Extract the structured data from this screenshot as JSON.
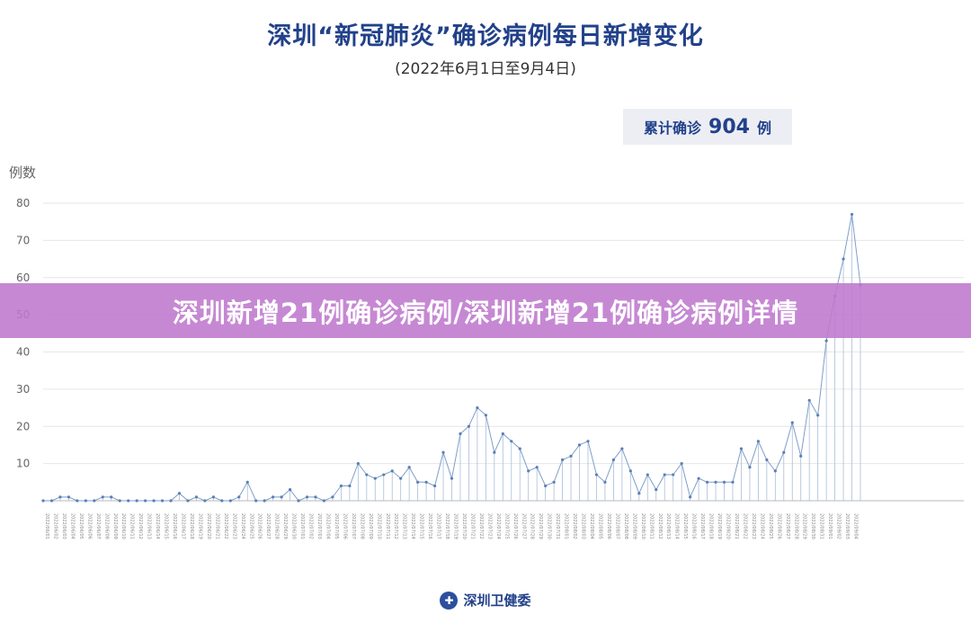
{
  "header": {
    "title": "深圳“新冠肺炎”确诊病例每日新增变化",
    "subtitle": "(2022年6月1日至9月4日)"
  },
  "summary": {
    "label": "累计确诊",
    "value": "904",
    "unit": "例"
  },
  "banner": {
    "text": "深圳新增21例确诊病例/深圳新增21例确诊病例详情"
  },
  "footer": {
    "source": "深圳卫健委",
    "logo_icon": "health-commission-logo-icon"
  },
  "colors": {
    "title": "#22418a",
    "line": "#7f9ec9",
    "marker": "#5b7fb5",
    "axis_text": "#666666",
    "banner": "#be78cd"
  },
  "chart_data": {
    "type": "line",
    "ylabel": "例数",
    "ylim": [
      0,
      80
    ],
    "yticks": [
      10,
      20,
      30,
      40,
      50,
      60,
      70,
      80
    ],
    "drop_lines": true,
    "x_start": "2022-06-01",
    "x_end": "2022-09-04",
    "x": [
      "2022-06-01",
      "2022-06-02",
      "2022-06-03",
      "2022-06-04",
      "2022-06-05",
      "2022-06-06",
      "2022-06-07",
      "2022-06-08",
      "2022-06-09",
      "2022-06-10",
      "2022-06-11",
      "2022-06-12",
      "2022-06-13",
      "2022-06-14",
      "2022-06-15",
      "2022-06-16",
      "2022-06-17",
      "2022-06-18",
      "2022-06-19",
      "2022-06-20",
      "2022-06-21",
      "2022-06-22",
      "2022-06-23",
      "2022-06-24",
      "2022-06-25",
      "2022-06-26",
      "2022-06-27",
      "2022-06-28",
      "2022-06-29",
      "2022-06-30",
      "2022-07-01",
      "2022-07-02",
      "2022-07-03",
      "2022-07-04",
      "2022-07-05",
      "2022-07-06",
      "2022-07-07",
      "2022-07-08",
      "2022-07-09",
      "2022-07-10",
      "2022-07-11",
      "2022-07-12",
      "2022-07-13",
      "2022-07-14",
      "2022-07-15",
      "2022-07-16",
      "2022-07-17",
      "2022-07-18",
      "2022-07-19",
      "2022-07-20",
      "2022-07-21",
      "2022-07-22",
      "2022-07-23",
      "2022-07-24",
      "2022-07-25",
      "2022-07-26",
      "2022-07-27",
      "2022-07-28",
      "2022-07-29",
      "2022-07-30",
      "2022-07-31",
      "2022-08-01",
      "2022-08-02",
      "2022-08-03",
      "2022-08-04",
      "2022-08-05",
      "2022-08-06",
      "2022-08-07",
      "2022-08-08",
      "2022-08-09",
      "2022-08-10",
      "2022-08-11",
      "2022-08-12",
      "2022-08-13",
      "2022-08-14",
      "2022-08-15",
      "2022-08-16",
      "2022-08-17",
      "2022-08-18",
      "2022-08-19",
      "2022-08-20",
      "2022-08-21",
      "2022-08-22",
      "2022-08-23",
      "2022-08-24",
      "2022-08-25",
      "2022-08-26",
      "2022-08-27",
      "2022-08-28",
      "2022-08-29",
      "2022-08-30",
      "2022-08-31",
      "2022-09-01",
      "2022-09-02",
      "2022-09-03",
      "2022-09-04"
    ],
    "values": [
      0,
      0,
      1,
      1,
      0,
      0,
      0,
      1,
      1,
      0,
      0,
      0,
      0,
      0,
      0,
      0,
      2,
      0,
      1,
      0,
      1,
      0,
      0,
      1,
      5,
      0,
      0,
      1,
      1,
      3,
      0,
      1,
      1,
      0,
      1,
      4,
      4,
      10,
      7,
      6,
      7,
      8,
      6,
      9,
      5,
      5,
      4,
      13,
      6,
      18,
      20,
      25,
      23,
      13,
      18,
      16,
      14,
      8,
      9,
      4,
      5,
      11,
      12,
      15,
      16,
      7,
      5,
      11,
      14,
      8,
      2,
      7,
      3,
      7,
      7,
      10,
      1,
      6,
      5,
      5,
      5,
      5,
      14,
      9,
      16,
      11,
      8,
      13,
      21,
      12,
      27,
      23,
      43,
      55,
      65,
      77,
      58
    ]
  }
}
